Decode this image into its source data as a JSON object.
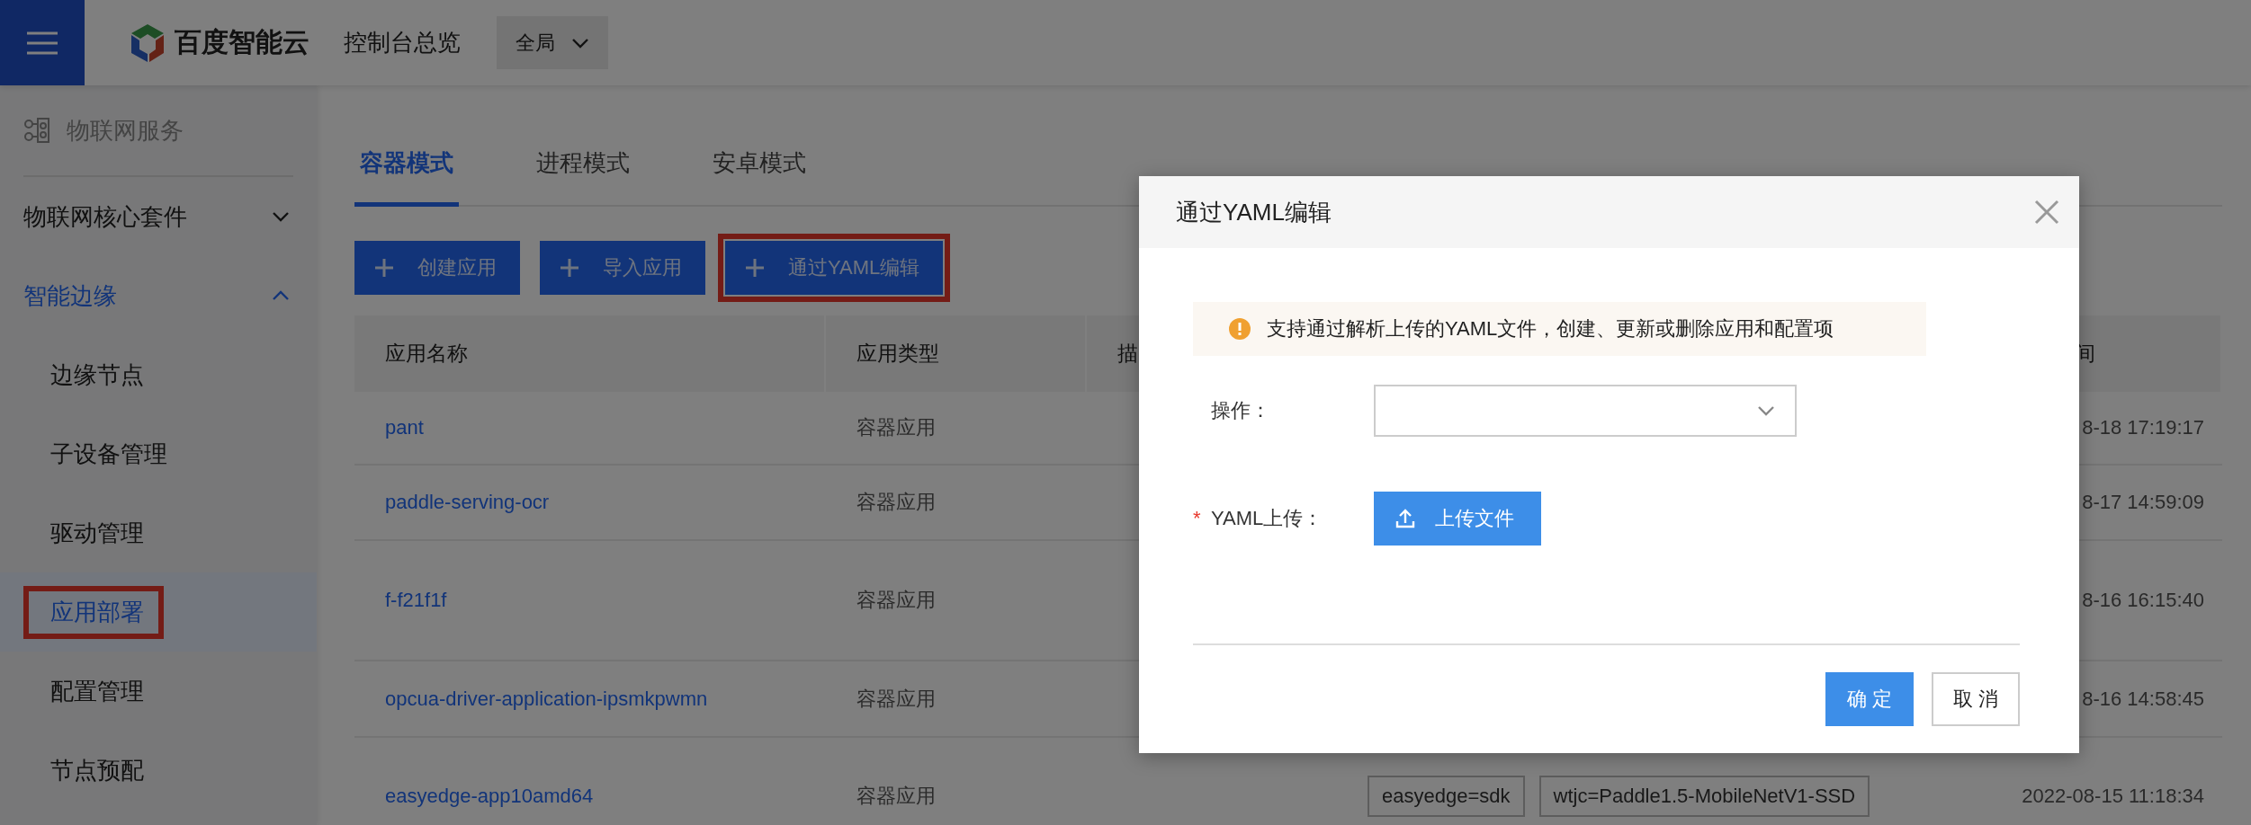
{
  "header": {
    "brand": "百度智能云",
    "title": "控制台总览",
    "region": "全局"
  },
  "sidebar": {
    "service": "物联网服务",
    "groups": [
      {
        "label": "物联网核心套件",
        "expanded": false
      },
      {
        "label": "智能边缘",
        "expanded": true,
        "children": [
          {
            "label": "边缘节点",
            "selected": false,
            "outlined": false
          },
          {
            "label": "子设备管理",
            "selected": false,
            "outlined": false
          },
          {
            "label": "驱动管理",
            "selected": false,
            "outlined": false
          },
          {
            "label": "应用部署",
            "selected": true,
            "outlined": true
          },
          {
            "label": "配置管理",
            "selected": false,
            "outlined": false
          },
          {
            "label": "节点预配",
            "selected": false,
            "outlined": false
          }
        ]
      }
    ]
  },
  "tabs": [
    {
      "label": "容器模式",
      "selected": true
    },
    {
      "label": "进程模式",
      "selected": false
    },
    {
      "label": "安卓模式",
      "selected": false
    }
  ],
  "toolbar": [
    {
      "label": "创建应用",
      "outlined": false
    },
    {
      "label": "导入应用",
      "outlined": false
    },
    {
      "label": "通过YAML编辑",
      "outlined": true
    }
  ],
  "table": {
    "columns": [
      "应用名称",
      "应用类型",
      "描",
      "间"
    ],
    "rows": [
      {
        "name": "pant",
        "type": "容器应用",
        "time": "8-18 17:19:17"
      },
      {
        "name": "paddle-serving-ocr",
        "type": "容器应用",
        "time": "8-17 14:59:09"
      },
      {
        "name": "f-f21f1f",
        "type": "容器应用",
        "time": "8-16 16:15:40"
      },
      {
        "name": "opcua-driver-application-ipsmkpwmn",
        "type": "容器应用",
        "time": "8-16 14:58:45"
      },
      {
        "name": "easyedge-app10amd64",
        "type": "容器应用",
        "tags": [
          "easyedge=sdk",
          "wtjc=Paddle1.5-MobileNetV1-SSD"
        ],
        "time": "2022-08-15 11:18:34"
      }
    ]
  },
  "dialog": {
    "title": "通过YAML编辑",
    "notice": "支持通过解析上传的YAML文件，创建、更新或删除应用和配置项",
    "fields": [
      {
        "kind": "select",
        "label": "操作："
      },
      {
        "kind": "upload",
        "label": "YAML上传：",
        "required_mark": "*",
        "button": "上传文件"
      }
    ],
    "buttons": [
      {
        "label": "确 定",
        "kind": "primary"
      },
      {
        "label": "取 消",
        "kind": "default"
      }
    ]
  }
}
